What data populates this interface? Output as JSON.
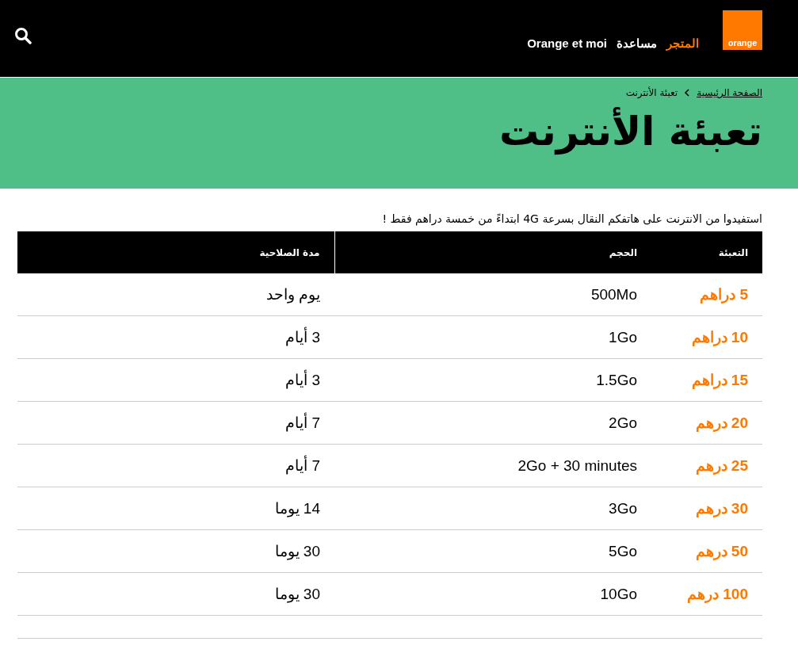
{
  "header": {
    "logo": "orange",
    "nav": [
      {
        "label": "المتجر",
        "selected": true
      },
      {
        "label": "مساعدة",
        "selected": false
      },
      {
        "label": "Orange et moi",
        "selected": false
      }
    ]
  },
  "breadcrumb": [
    {
      "label": "الصفحة الرئيسية",
      "kind": "link"
    },
    {
      "label": "تعبئة الأنترنت",
      "kind": "current"
    }
  ],
  "title": "تعبئة الأنترنت",
  "intro": "استفيدوا من الانترنت على هاتفكم النقال بسرعة 4G ابتداءً من خمسة دراهم فقط !",
  "table": {
    "columns": [
      "التعبئة",
      "الحجم",
      "مدة الصلاحية"
    ],
    "rows": [
      [
        "5 دراهم",
        "500Mo",
        "يوم واحد"
      ],
      [
        "10 دراهم",
        "1Go",
        "3 أيام"
      ],
      [
        "15 دراهم",
        "1.5Go",
        "3 أيام"
      ],
      [
        "20 درهم",
        "2Go",
        "7 أيام"
      ],
      [
        "25 درهم",
        "2Go + 30 minutes",
        "7 أيام"
      ],
      [
        "30 درهم",
        "3Go",
        "14 يوما"
      ],
      [
        "50 درهم",
        "5Go",
        "30 يوما"
      ],
      [
        "100 درهم",
        "10Go",
        "30 يوما"
      ]
    ]
  }
}
